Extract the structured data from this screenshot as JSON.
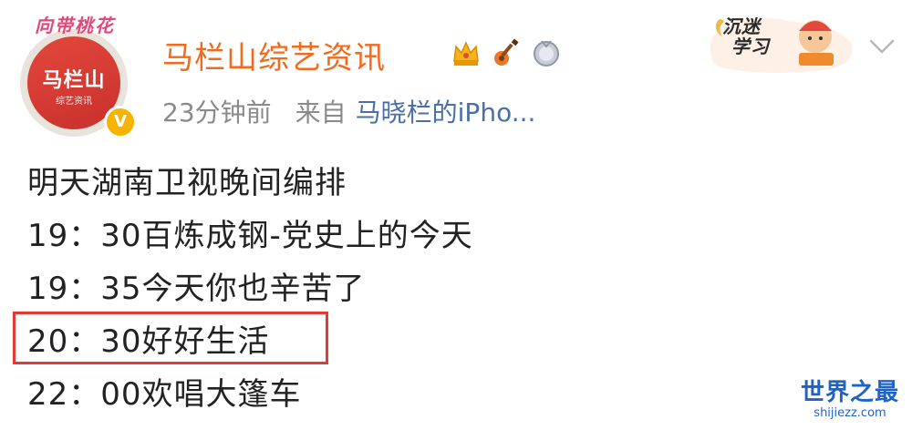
{
  "post": {
    "avatar": {
      "pendant_text": "向带桃花",
      "name_text": "马栏山",
      "sub_text": "综艺资讯",
      "verified_mark": "V"
    },
    "username": "马栏山综艺资讯",
    "badges": [
      "crown-icon",
      "guitar-icon",
      "medal-icon"
    ],
    "time": "23分钟前",
    "source_prefix": "来自",
    "source_device": "马晓栏的iPho...",
    "banner_text_1": "沉迷",
    "banner_text_2": "学习",
    "lines": [
      "明天湖南卫视晚间编排",
      "19：30百炼成钢-党史上的今天",
      "19：35今天你也辛苦了",
      "20：30好好生活",
      "22：00欢唱大篷车"
    ]
  },
  "watermark": {
    "main": "世界之最",
    "sub": "shijiezz.com"
  },
  "colors": {
    "username": "#f36a1d",
    "meta": "#8a8a8a",
    "device": "#4a6ea8",
    "highlight": "#e53935",
    "watermark": "#1e63c4"
  }
}
